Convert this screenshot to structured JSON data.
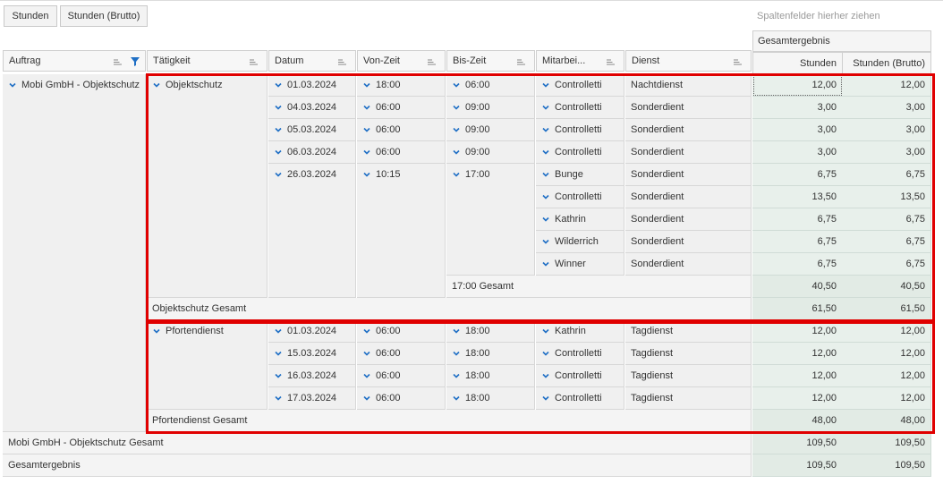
{
  "data_area_chips": [
    "Stunden",
    "Stunden (Brutto)"
  ],
  "column_drop_hint": "Spaltenfelder hierher ziehen",
  "grand_total_header": "Gesamtergebnis",
  "data_headers": [
    "Stunden",
    "Stunden (Brutto)"
  ],
  "row_headers": [
    "Auftrag",
    "Tätigkeit",
    "Datum",
    "Von-Zeit",
    "Bis-Zeit",
    "Mitarbei...",
    "Dienst"
  ],
  "auftrag": "Mobi GmbH - Objektschutz",
  "taetigkeiten": [
    "Objektschutz",
    "Pfortendienst"
  ],
  "rows": [
    {
      "datum": "01.03.2024",
      "von": "18:00",
      "bis": "06:00",
      "mitarbeiter": "Controlletti",
      "dienst": "Nachtdienst",
      "stunden": "12,00",
      "brutto": "12,00"
    },
    {
      "datum": "04.03.2024",
      "von": "06:00",
      "bis": "09:00",
      "mitarbeiter": "Controlletti",
      "dienst": "Sonderdient",
      "stunden": "3,00",
      "brutto": "3,00"
    },
    {
      "datum": "05.03.2024",
      "von": "06:00",
      "bis": "09:00",
      "mitarbeiter": "Controlletti",
      "dienst": "Sonderdient",
      "stunden": "3,00",
      "brutto": "3,00"
    },
    {
      "datum": "06.03.2024",
      "von": "06:00",
      "bis": "09:00",
      "mitarbeiter": "Controlletti",
      "dienst": "Sonderdient",
      "stunden": "3,00",
      "brutto": "3,00"
    },
    {
      "datum": "26.03.2024",
      "von": "10:15",
      "bis": "17:00",
      "mitarbeiter": "Bunge",
      "dienst": "Sonderdient",
      "stunden": "6,75",
      "brutto": "6,75"
    },
    {
      "mitarbeiter": "Controlletti",
      "dienst": "Sonderdient",
      "stunden": "13,50",
      "brutto": "13,50"
    },
    {
      "mitarbeiter": "Kathrin",
      "dienst": "Sonderdient",
      "stunden": "6,75",
      "brutto": "6,75"
    },
    {
      "mitarbeiter": "Wilderrich",
      "dienst": "Sonderdient",
      "stunden": "6,75",
      "brutto": "6,75"
    },
    {
      "mitarbeiter": "Winner",
      "dienst": "Sonderdient",
      "stunden": "6,75",
      "brutto": "6,75"
    },
    {
      "subtotal_label": "17:00 Gesamt",
      "stunden": "40,50",
      "brutto": "40,50"
    },
    {
      "total_label": "Objektschutz Gesamt",
      "stunden": "61,50",
      "brutto": "61,50"
    },
    {
      "datum": "01.03.2024",
      "von": "06:00",
      "bis": "18:00",
      "mitarbeiter": "Kathrin",
      "dienst": "Tagdienst",
      "stunden": "12,00",
      "brutto": "12,00"
    },
    {
      "datum": "15.03.2024",
      "von": "06:00",
      "bis": "18:00",
      "mitarbeiter": "Controlletti",
      "dienst": "Tagdienst",
      "stunden": "12,00",
      "brutto": "12,00"
    },
    {
      "datum": "16.03.2024",
      "von": "06:00",
      "bis": "18:00",
      "mitarbeiter": "Controlletti",
      "dienst": "Tagdienst",
      "stunden": "12,00",
      "brutto": "12,00"
    },
    {
      "datum": "17.03.2024",
      "von": "06:00",
      "bis": "18:00",
      "mitarbeiter": "Controlletti",
      "dienst": "Tagdienst",
      "stunden": "12,00",
      "brutto": "12,00"
    },
    {
      "total_label": "Pfortendienst Gesamt",
      "stunden": "48,00",
      "brutto": "48,00"
    },
    {
      "total_label": "Mobi GmbH - Objektschutz Gesamt",
      "stunden": "109,50",
      "brutto": "109,50"
    },
    {
      "total_label": "Gesamtergebnis",
      "stunden": "109,50",
      "brutto": "109,50"
    }
  ],
  "colors": {
    "highlight_border": "#e00000",
    "data_cell_bg": "#e8f0eb",
    "row_area_bg": "#f0f0f0",
    "chevron": "#1f6fc5",
    "filter_icon": "#1f6fc5"
  }
}
